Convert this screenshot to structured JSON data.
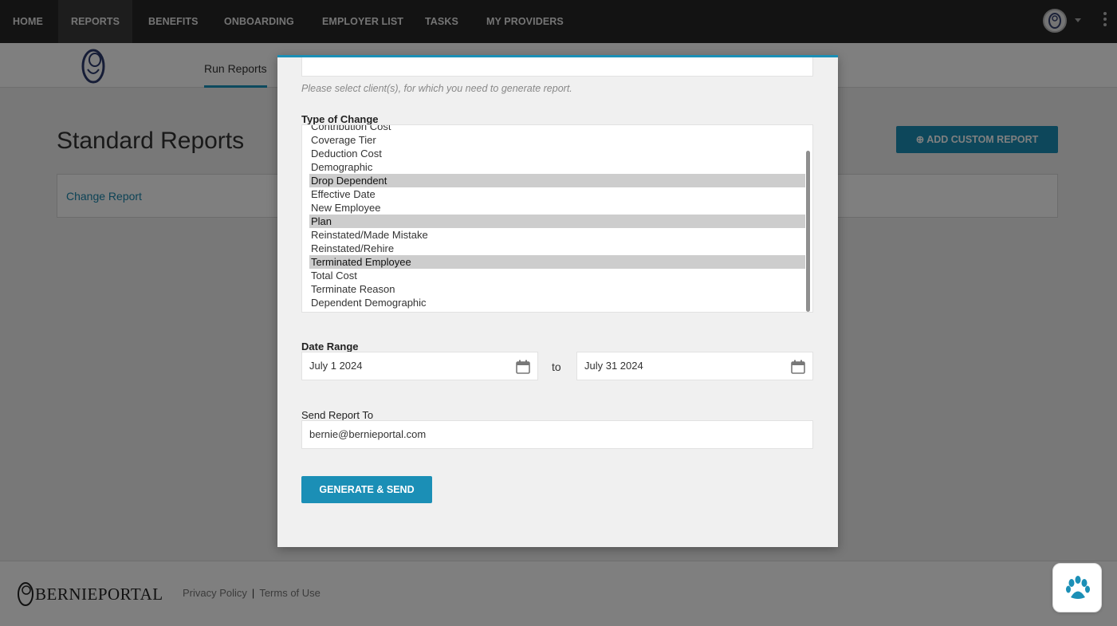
{
  "nav": {
    "items": [
      {
        "label": "HOME"
      },
      {
        "label": "REPORTS"
      },
      {
        "label": "BENEFITS"
      },
      {
        "label": "ONBOARDING"
      },
      {
        "label": "EMPLOYER LIST"
      },
      {
        "label": "TASKS"
      },
      {
        "label": "MY PROVIDERS"
      }
    ],
    "active_index": 1
  },
  "subnav": {
    "tab_label": "Run Reports"
  },
  "page": {
    "title": "Standard Reports",
    "add_button_label": "ADD CUSTOM REPORT",
    "add_button_icon": "plus-circle-icon",
    "report_link": "Change Report"
  },
  "modal": {
    "client_help": "Please select client(s), for which you need to generate report.",
    "type_label": "Type of Change",
    "type_options": [
      {
        "label": "Contribution Cost",
        "selected": false
      },
      {
        "label": "Coverage Tier",
        "selected": false
      },
      {
        "label": "Deduction Cost",
        "selected": false
      },
      {
        "label": "Demographic",
        "selected": false
      },
      {
        "label": "Drop Dependent",
        "selected": true
      },
      {
        "label": "Effective Date",
        "selected": false
      },
      {
        "label": "New Employee",
        "selected": false
      },
      {
        "label": "Plan",
        "selected": true
      },
      {
        "label": "Reinstated/Made Mistake",
        "selected": false
      },
      {
        "label": "Reinstated/Rehire",
        "selected": false
      },
      {
        "label": "Terminated Employee",
        "selected": true
      },
      {
        "label": "Total Cost",
        "selected": false
      },
      {
        "label": "Terminate Reason",
        "selected": false
      },
      {
        "label": "Dependent Demographic",
        "selected": false
      }
    ],
    "date_label": "Date Range",
    "date_from": "July 1 2024",
    "date_to_word": "to",
    "date_to": "July 31 2024",
    "send_label": "Send Report To",
    "send_email": "bernie@bernieportal.com",
    "generate_button": "GENERATE & SEND"
  },
  "footer": {
    "brand": "BERNIEPORTAL",
    "privacy": "Privacy Policy",
    "separator": "|",
    "terms": "Terms of Use",
    "chat_icon": "paw-icon"
  },
  "colors": {
    "accent": "#1b8fb6",
    "nav_bg": "#262626",
    "selected_row": "#cdcdcd"
  }
}
